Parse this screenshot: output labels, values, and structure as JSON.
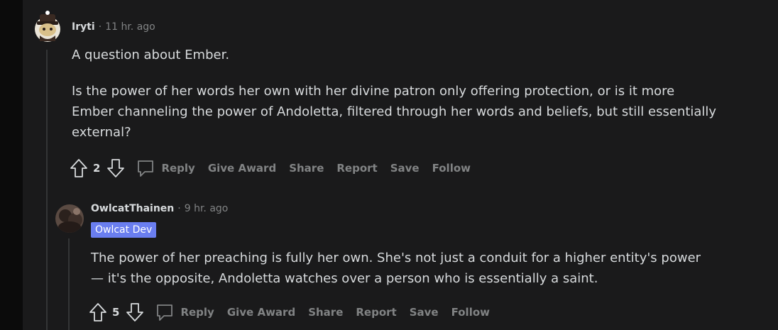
{
  "comments": [
    {
      "author": "Iryti",
      "separator": "·",
      "time": "11 hr. ago",
      "paragraphs": [
        "A question about Ember.",
        "Is the power of her words her own with her divine patron only offering protection, or is it more Ember channeling the power of Andoletta, filtered through her words and beliefs, but still essentially external?"
      ],
      "score": "2",
      "actions": {
        "reply": "Reply",
        "give_award": "Give Award",
        "share": "Share",
        "report": "Report",
        "save": "Save",
        "follow": "Follow"
      }
    },
    {
      "author": "OwlcatThainen",
      "separator": "·",
      "time": "9 hr. ago",
      "flair": "Owlcat Dev",
      "paragraphs": [
        "The power of her preaching is fully her own. She's not just a conduit for a higher entity's power — it's the opposite, Andoletta watches over a person who is essentially a saint."
      ],
      "score": "5",
      "actions": {
        "reply": "Reply",
        "give_award": "Give Award",
        "share": "Share",
        "report": "Report",
        "save": "Save",
        "follow": "Follow"
      }
    }
  ],
  "colors": {
    "background": "#1a1a1b",
    "text": "#d7dadc",
    "muted": "#818384",
    "flair": "#6a7ef0"
  }
}
